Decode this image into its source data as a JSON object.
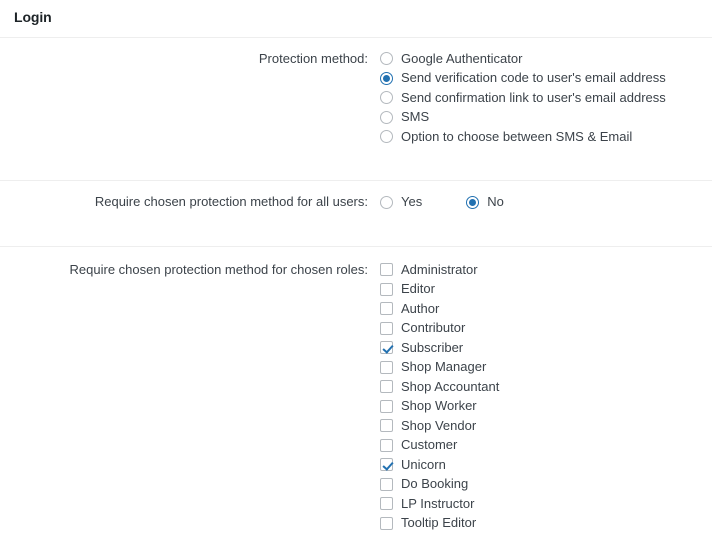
{
  "section": {
    "title": "Login"
  },
  "rows": {
    "protection_method": {
      "label": "Protection method:",
      "options": [
        {
          "label": "Google Authenticator",
          "checked": false
        },
        {
          "label": "Send verification code to user's email address",
          "checked": true
        },
        {
          "label": "Send confirmation link to user's email address",
          "checked": false
        },
        {
          "label": "SMS",
          "checked": false
        },
        {
          "label": "Option to choose between SMS & Email",
          "checked": false
        }
      ]
    },
    "require_all_users": {
      "label": "Require chosen protection method for all users:",
      "options": [
        {
          "label": "Yes",
          "checked": false
        },
        {
          "label": "No",
          "checked": true
        }
      ]
    },
    "require_chosen_roles": {
      "label": "Require chosen protection method for chosen roles:",
      "options": [
        {
          "label": "Administrator",
          "checked": false
        },
        {
          "label": "Editor",
          "checked": false
        },
        {
          "label": "Author",
          "checked": false
        },
        {
          "label": "Contributor",
          "checked": false
        },
        {
          "label": "Subscriber",
          "checked": true
        },
        {
          "label": "Shop Manager",
          "checked": false
        },
        {
          "label": "Shop Accountant",
          "checked": false
        },
        {
          "label": "Shop Worker",
          "checked": false
        },
        {
          "label": "Shop Vendor",
          "checked": false
        },
        {
          "label": "Customer",
          "checked": false
        },
        {
          "label": "Unicorn",
          "checked": true
        },
        {
          "label": "Do Booking",
          "checked": false
        },
        {
          "label": "LP Instructor",
          "checked": false
        },
        {
          "label": "Tooltip Editor",
          "checked": false
        }
      ]
    }
  },
  "colors": {
    "accent": "#2271b1",
    "text": "#3c434a",
    "heading": "#1d2327",
    "divider": "#eeeeee",
    "control_border": "#b4b9be"
  }
}
